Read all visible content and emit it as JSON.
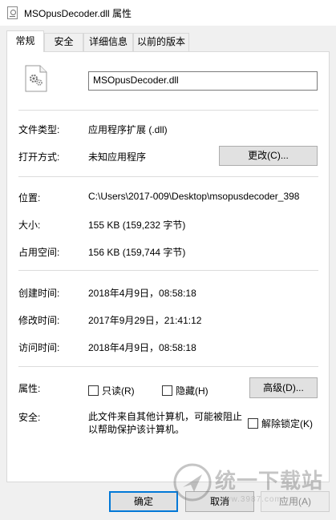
{
  "window": {
    "title": "MSOpusDecoder.dll 属性"
  },
  "tabs": [
    {
      "label": "常规",
      "active": true
    },
    {
      "label": "安全",
      "active": false
    },
    {
      "label": "详细信息",
      "active": false
    },
    {
      "label": "以前的版本",
      "active": false
    }
  ],
  "general": {
    "file_name": "MSOpusDecoder.dll",
    "file_type_label": "文件类型:",
    "file_type_value": "应用程序扩展 (.dll)",
    "open_with_label": "打开方式:",
    "open_with_value": "未知应用程序",
    "change_button": "更改(C)...",
    "location_label": "位置:",
    "location_value": "C:\\Users\\2017-009\\Desktop\\msopusdecoder_398",
    "size_label": "大小:",
    "size_value": "155 KB (159,232 字节)",
    "size_on_disk_label": "占用空间:",
    "size_on_disk_value": "156 KB (159,744 字节)",
    "created_label": "创建时间:",
    "created_value": "2018年4月9日，08:58:18",
    "modified_label": "修改时间:",
    "modified_value": "2017年9月29日，21:41:12",
    "accessed_label": "访问时间:",
    "accessed_value": "2018年4月9日，08:58:18",
    "attributes_label": "属性:",
    "readonly_label": "只读(R)",
    "readonly_checked": false,
    "hidden_label": "隐藏(H)",
    "hidden_checked": false,
    "advanced_button": "高级(D)...",
    "security_label": "安全:",
    "security_text": "此文件来自其他计算机，可能被阻止以帮助保护该计算机。",
    "unblock_label": "解除锁定(K)",
    "unblock_checked": false
  },
  "footer": {
    "ok_button": "确定",
    "cancel_button": "取消",
    "apply_button": "应用(A)"
  },
  "watermark": {
    "text": "统一下载站",
    "url": "www.3987.com"
  }
}
